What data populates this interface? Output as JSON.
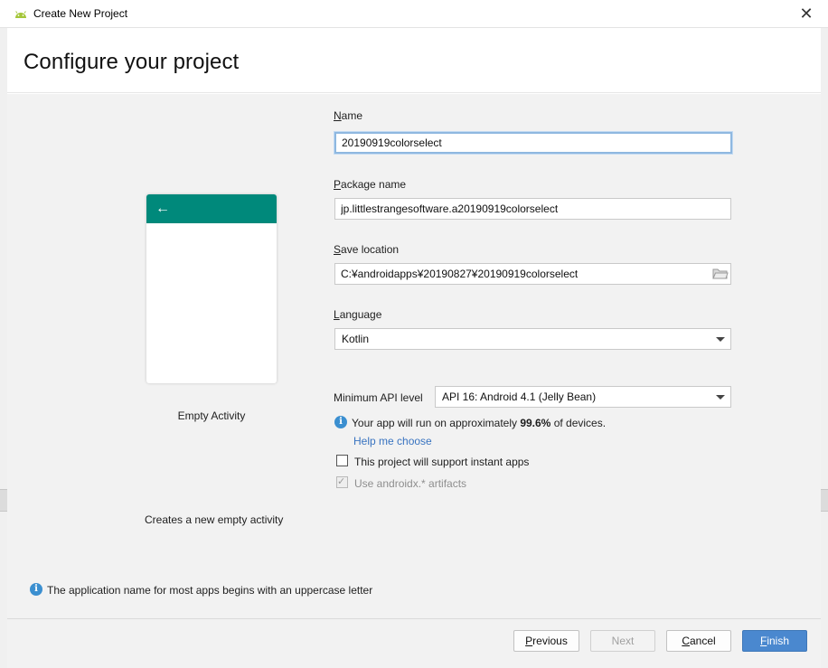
{
  "window": {
    "title": "Create New Project",
    "close_glyph": "✕"
  },
  "header": {
    "title": "Configure your project"
  },
  "template": {
    "name": "Empty Activity",
    "description": "Creates a new empty activity",
    "appbar_color": "#00897b",
    "back_icon": "←"
  },
  "form": {
    "name": {
      "mnemonic": "N",
      "rest": "ame",
      "value": "20190919colorselect"
    },
    "package": {
      "mnemonic": "P",
      "rest": "ackage name",
      "value": "jp.littlestrangesoftware.a20190919colorselect"
    },
    "location": {
      "mnemonic": "S",
      "rest": "ave location",
      "value": "C:¥androidapps¥20190827¥20190919colorselect"
    },
    "language": {
      "mnemonic": "L",
      "rest": "anguage",
      "value": "Kotlin"
    },
    "min_api": {
      "label": "Minimum API level",
      "value": "API 16: Android 4.1 (Jelly Bean)"
    },
    "api_info": {
      "prefix": "Your app will run on approximately ",
      "percent": "99.6%",
      "suffix": " of devices."
    },
    "help_link": "Help me choose",
    "instant_apps": {
      "label": "This project will support instant apps",
      "checked": false
    },
    "androidx": {
      "label": "Use androidx.* artifacts",
      "checked": true,
      "enabled": false
    }
  },
  "hint": "The application name for most apps begins with an uppercase letter",
  "buttons": {
    "previous": {
      "mnemonic": "P",
      "rest": "revious"
    },
    "next": "Next",
    "cancel": {
      "mnemonic": "C",
      "rest": "ancel"
    },
    "finish": {
      "mnemonic": "F",
      "rest": "inish"
    }
  },
  "colors": {
    "accent": "#4a88cf",
    "link": "#3873c0",
    "info": "#3b8fd0"
  }
}
